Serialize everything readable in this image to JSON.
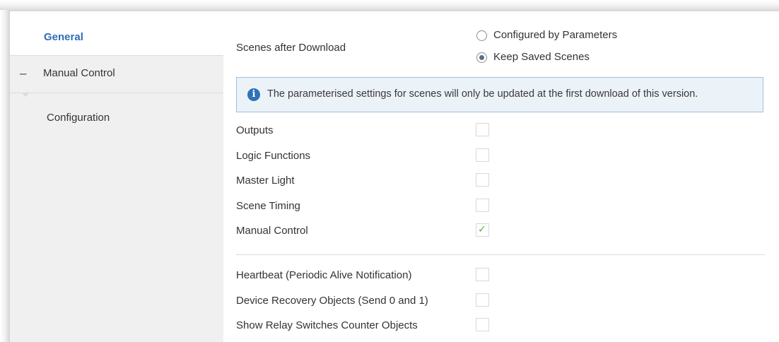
{
  "sidebar": {
    "items": [
      {
        "label": "General",
        "selected": true
      },
      {
        "label": "Manual Control",
        "collapse_symbol": "–"
      },
      {
        "label": "Configuration"
      }
    ]
  },
  "scenes": {
    "label": "Scenes after Download",
    "options": [
      {
        "label": "Configured by Parameters",
        "selected": false
      },
      {
        "label": "Keep Saved Scenes",
        "selected": true
      }
    ]
  },
  "info": {
    "icon": "info-icon",
    "icon_glyph": "i",
    "text": "The parameterised settings for scenes will only be updated at the first download of this version."
  },
  "options_group1": [
    {
      "label": "Outputs",
      "checked": false
    },
    {
      "label": "Logic Functions",
      "checked": false
    },
    {
      "label": "Master Light",
      "checked": false
    },
    {
      "label": "Scene Timing",
      "checked": false
    },
    {
      "label": "Manual Control",
      "checked": true
    }
  ],
  "options_group2": [
    {
      "label": "Heartbeat (Periodic Alive Notification)",
      "checked": false
    },
    {
      "label": "Device Recovery Objects (Send 0 and 1)",
      "checked": false
    },
    {
      "label": "Show Relay Switches Counter Objects",
      "checked": false
    }
  ],
  "check_glyph": "✓",
  "colors": {
    "accent": "#2f6db8",
    "sidebar_bg": "#f0f0f0",
    "info_bg": "#ebf2f8",
    "info_border": "#9fc0dc",
    "check": "#5aaa4a"
  }
}
